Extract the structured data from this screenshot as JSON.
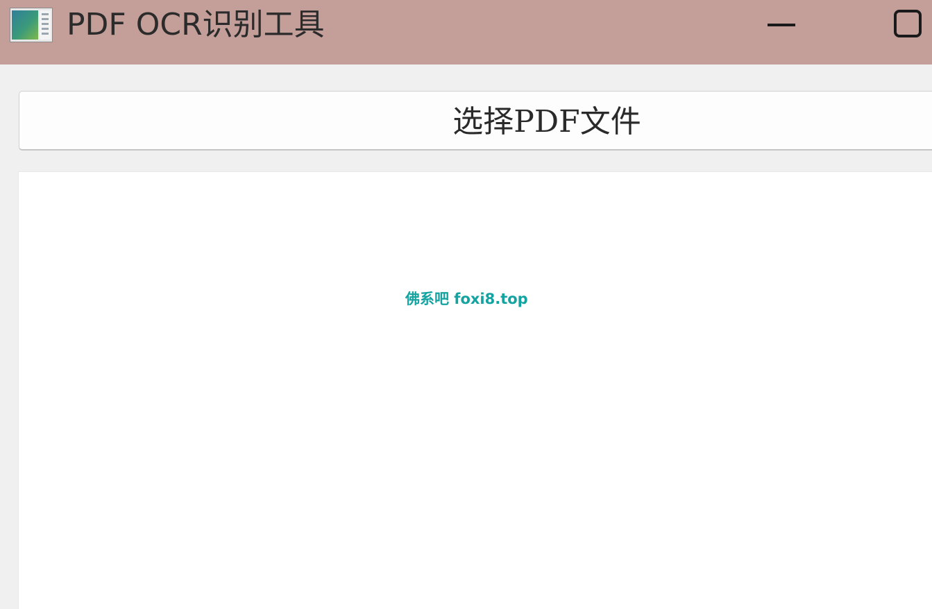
{
  "window": {
    "title": "PDF OCR识别工具",
    "icon": "pdf-document-icon",
    "controls": {
      "minimize_icon": "minimize-icon",
      "maximize_icon": "maximize-icon"
    },
    "titlebar_color": "#c49e98"
  },
  "toolbar": {
    "select_pdf_label": "选择PDF文件"
  },
  "result_area": {
    "text": ""
  },
  "watermark": {
    "text": "佛系吧  foxi8.top",
    "color": "#13a3a0"
  }
}
